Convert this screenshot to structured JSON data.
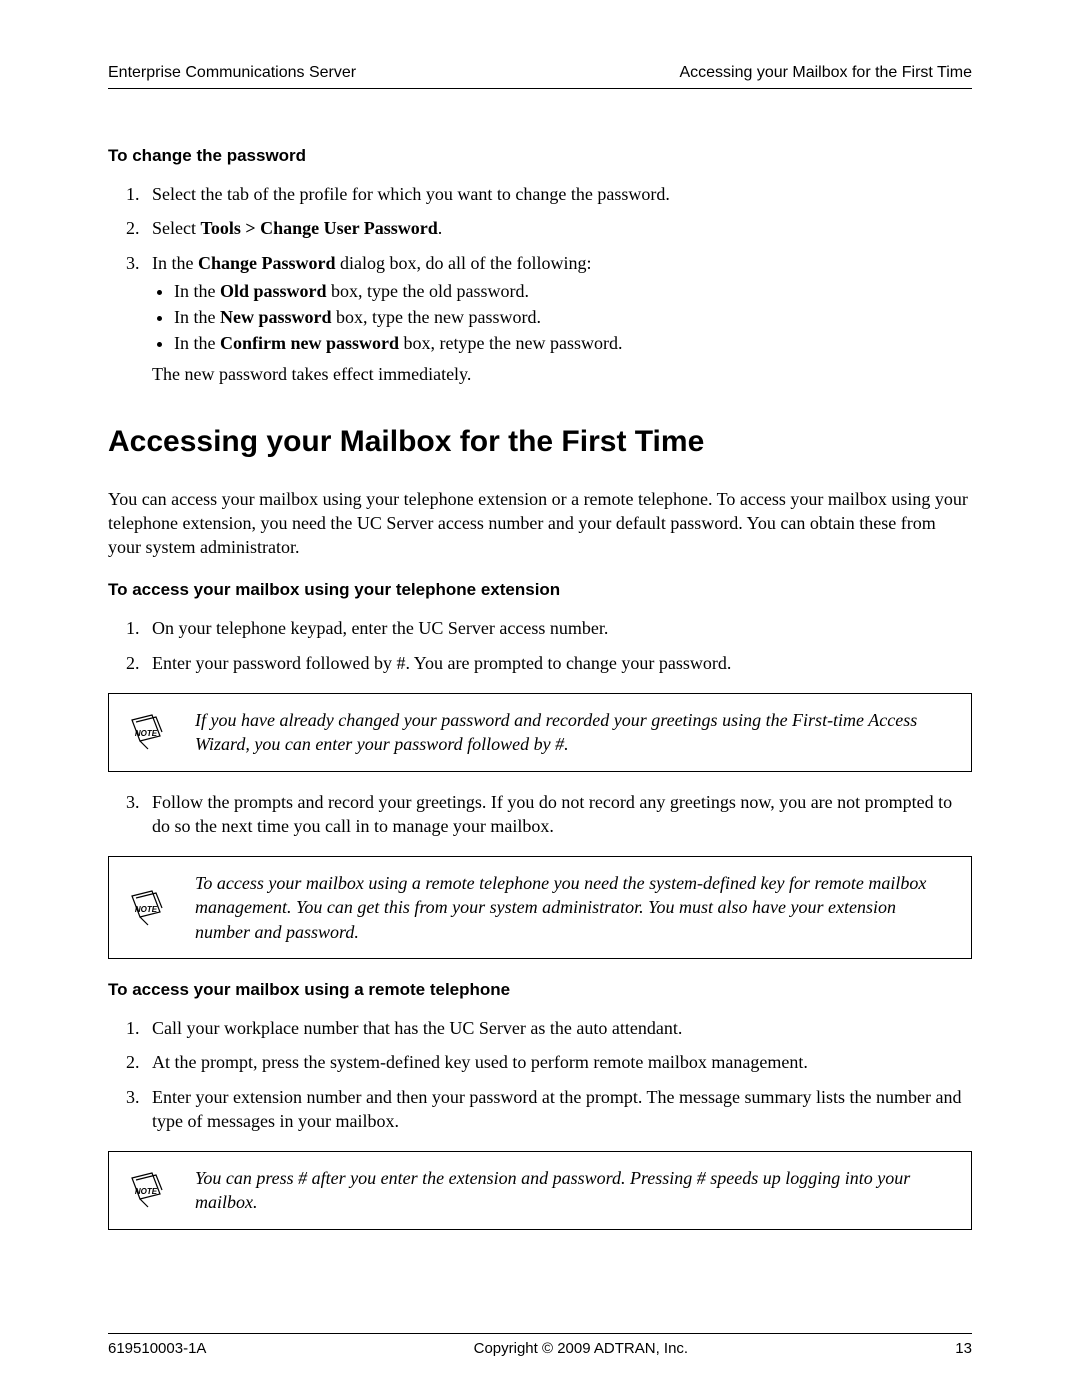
{
  "header": {
    "left": "Enterprise Communications Server",
    "right": "Accessing your Mailbox for the First Time"
  },
  "section_change_pw": {
    "heading": "To change the password",
    "steps": {
      "s1": "Select the tab of the profile for which you want to change the password.",
      "s2_pre": "Select ",
      "s2_b": "Tools > Change User Password",
      "s2_post": ".",
      "s3_pre": "In the ",
      "s3_b": "Change Password",
      "s3_post": " dialog box, do all of the following:",
      "b1_pre": "In the ",
      "b1_b": "Old password",
      "b1_post": " box, type the old password.",
      "b2_pre": "In the ",
      "b2_b": "New password",
      "b2_post": " box, type the new password.",
      "b3_pre": "In the ",
      "b3_b": "Confirm new password",
      "b3_post": " box, retype the new password.",
      "s3_after": "The new password takes effect immediately."
    }
  },
  "section_access": {
    "title": "Accessing your Mailbox for the First Time",
    "intro": "You can access your mailbox using your telephone extension or a remote telephone. To access your mailbox using your telephone extension, you need the UC Server access number and your default password. You can obtain these from your system administrator.",
    "ext_heading": "To access your mailbox using your telephone extension",
    "ext_s1": "On your telephone keypad, enter the UC Server access number.",
    "ext_s2": "Enter your password followed by #. You are prompted to change your password.",
    "note1": "If you have already changed your password and recorded your greetings using the First-time Access Wizard, you can enter your password followed by #.",
    "ext_s3": "Follow the prompts and record your greetings. If you do not record any greetings now, you are not prompted to do so the next time you call in to manage your mailbox.",
    "note2": "To access your mailbox using a remote telephone you need the system-defined key for remote mailbox management. You can get this from your system administrator. You must also have your extension number and password.",
    "rem_heading": "To access your mailbox using a remote telephone",
    "rem_s1": "Call your workplace number that has the UC Server as the auto attendant.",
    "rem_s2": "At the prompt, press the system-defined key used to perform remote mailbox management.",
    "rem_s3": "Enter your extension number and then your password at the prompt. The message summary lists the number and type of messages in your mailbox.",
    "note3": "You can press # after you enter the extension and password. Pressing # speeds up logging into your mailbox."
  },
  "footer": {
    "left": "619510003-1A",
    "center": "Copyright © 2009 ADTRAN, Inc.",
    "right": "13"
  },
  "icons": {
    "note_label": "NOTE"
  }
}
